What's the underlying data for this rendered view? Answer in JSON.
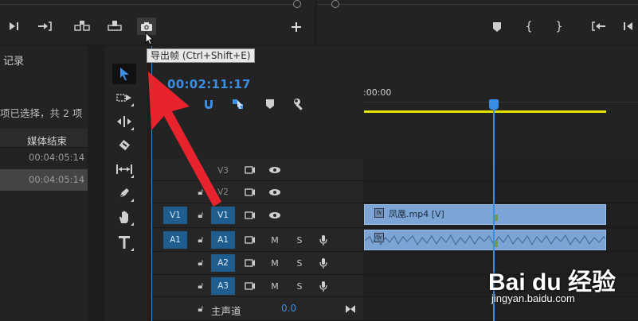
{
  "tooltip": {
    "text": "导出帧 (Ctrl+Shift+E)"
  },
  "project": {
    "title_partial": "记录",
    "selection_info": "项已选择，共 2 项",
    "column_header": "媒体结束",
    "rows": [
      "00:04:05:14",
      "00:04:05:14"
    ]
  },
  "timeline": {
    "timecode": "00:02:11:17",
    "ruler_start": ":00:00",
    "tracks": {
      "v3": "V3",
      "v2": "V2",
      "v1": "V1",
      "a1": "A1",
      "a2": "A2",
      "a3": "A3",
      "source_v1": "V1",
      "source_a1": "A1",
      "mute": "M",
      "solo": "S"
    },
    "master": {
      "label": "主声道",
      "value": "0.0"
    },
    "clips": {
      "video_label": "凤凰.mp4 [V]",
      "fx_label": "fx"
    }
  },
  "watermark": {
    "logo": "Bai du 经验",
    "url": "jingyan.baidu.com"
  },
  "colors": {
    "accent": "#3a8ee6",
    "workarea": "#e4e400",
    "clip": "#7ca5d6",
    "arrow": "#e8232d",
    "target_on": "#1f5d8f"
  }
}
